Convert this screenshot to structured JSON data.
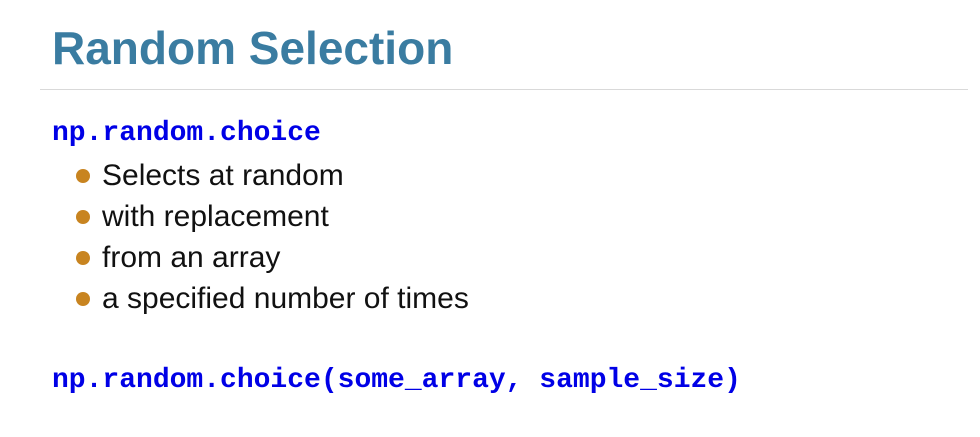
{
  "slide": {
    "title": "Random Selection",
    "function_name": "np.random.choice",
    "bullets": [
      "Selects at random",
      "with replacement",
      "from an array",
      "a specified number of times"
    ],
    "example_call": "np.random.choice(some_array, sample_size)"
  },
  "colors": {
    "title": "#3a7ca1",
    "code": "#0000e6",
    "bullet_dot": "#c88420",
    "body_text": "#111111"
  }
}
